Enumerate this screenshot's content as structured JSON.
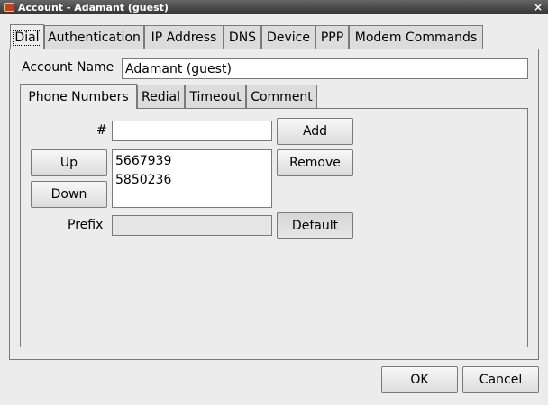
{
  "window": {
    "title": "Account - Adamant (guest)",
    "close_glyph": "×"
  },
  "tabs": [
    {
      "label": "Dial",
      "active": true
    },
    {
      "label": "Authentication"
    },
    {
      "label": "IP Address"
    },
    {
      "label": "DNS"
    },
    {
      "label": "Device"
    },
    {
      "label": "PPP"
    },
    {
      "label": "Modem Commands"
    }
  ],
  "account": {
    "name_label": "Account Name",
    "name_value": "Adamant (guest)"
  },
  "subtabs": [
    {
      "label": "Phone Numbers",
      "active": true
    },
    {
      "label": "Redial"
    },
    {
      "label": "Timeout"
    },
    {
      "label": "Comment"
    }
  ],
  "phone": {
    "number_label": "#",
    "number_value": "",
    "add_label": "Add",
    "remove_label": "Remove",
    "up_label": "Up",
    "down_label": "Down",
    "numbers": [
      "5667939",
      "5850236"
    ],
    "prefix_label": "Prefix",
    "prefix_value": "",
    "default_label": "Default"
  },
  "footer": {
    "ok_label": "OK",
    "cancel_label": "Cancel"
  }
}
